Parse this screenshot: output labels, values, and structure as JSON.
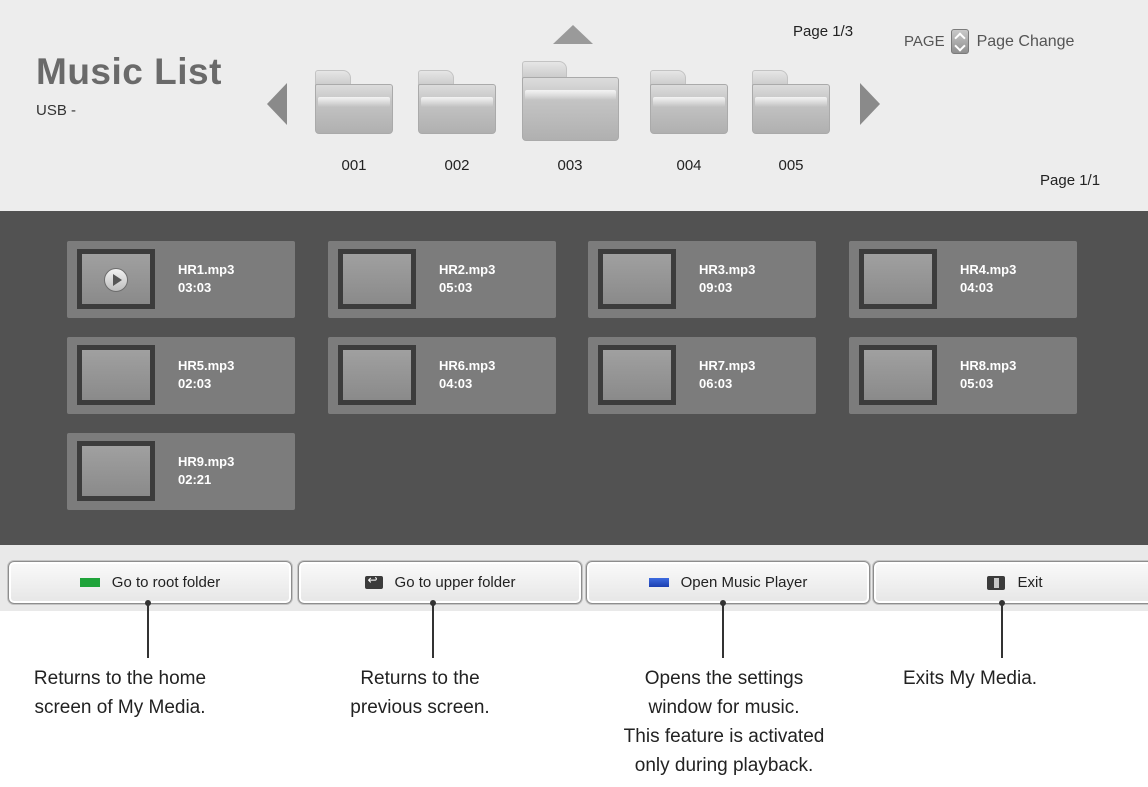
{
  "header": {
    "title": "Music List",
    "subtitle": "USB -",
    "page_top": "Page 1/3",
    "page_hint_key": "PAGE",
    "page_hint_label": "Page Change",
    "page_bottom": "Page 1/1"
  },
  "folders": [
    {
      "label": "001",
      "selected": false
    },
    {
      "label": "002",
      "selected": false
    },
    {
      "label": "003",
      "selected": true
    },
    {
      "label": "004",
      "selected": false
    },
    {
      "label": "005",
      "selected": false
    }
  ],
  "files": [
    {
      "name": "HR1.mp3",
      "duration": "03:03",
      "playing": true
    },
    {
      "name": "HR2.mp3",
      "duration": "05:03",
      "playing": false
    },
    {
      "name": "HR3.mp3",
      "duration": "09:03",
      "playing": false
    },
    {
      "name": "HR4.mp3",
      "duration": "04:03",
      "playing": false
    },
    {
      "name": "HR5.mp3",
      "duration": "02:03",
      "playing": false
    },
    {
      "name": "HR6.mp3",
      "duration": "04:03",
      "playing": false
    },
    {
      "name": "HR7.mp3",
      "duration": "06:03",
      "playing": false
    },
    {
      "name": "HR8.mp3",
      "duration": "05:03",
      "playing": false
    },
    {
      "name": "HR9.mp3",
      "duration": "02:21",
      "playing": false
    }
  ],
  "buttons": [
    {
      "label": "Go to root folder",
      "icon": "green-key-icon",
      "color": "#1fa33a"
    },
    {
      "label": "Go to upper folder",
      "icon": "back-key-icon"
    },
    {
      "label": "Open Music Player",
      "icon": "blue-key-icon",
      "color": "#2a53c8"
    },
    {
      "label": "Exit",
      "icon": "exit-key-icon"
    }
  ],
  "callouts": [
    {
      "line1": "Returns to the home",
      "line2": "screen of My Media."
    },
    {
      "line1": "Returns to the",
      "line2": "previous screen."
    },
    {
      "line1": "Opens the settings",
      "line2": "window for music.",
      "line3": "This feature is activated",
      "line4": "only during playback."
    },
    {
      "line1": "Exits My Media."
    }
  ],
  "colors": {
    "header_bg": "#ededed",
    "grid_bg": "#525252",
    "tile_bg": "#7c7c7c",
    "title_color": "#6a6a6a"
  }
}
